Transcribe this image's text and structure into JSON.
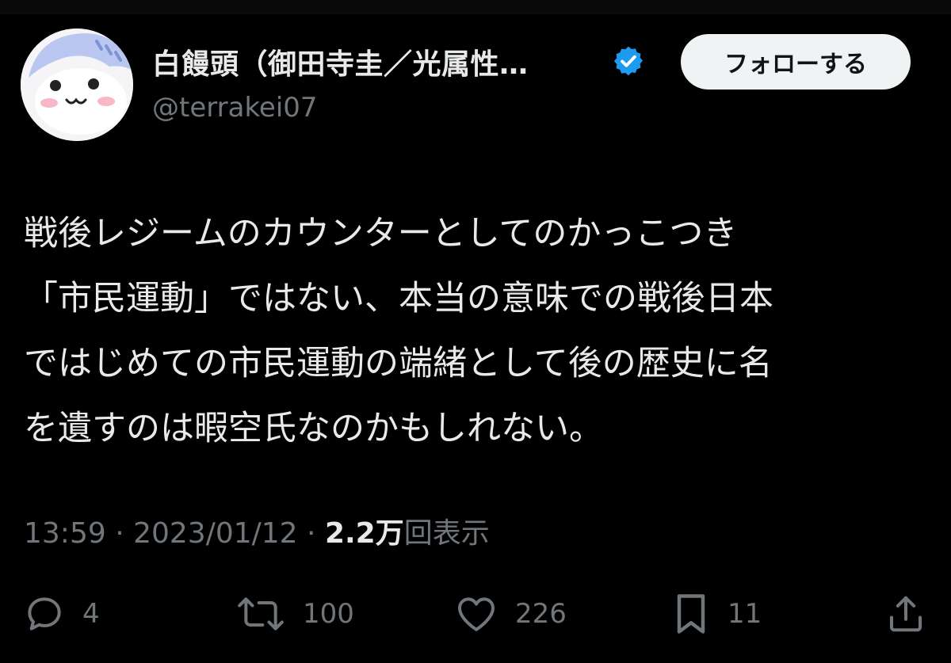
{
  "author": {
    "display_name": "白饅頭（御田寺圭／光属性…",
    "handle": "@terrakei07",
    "verified": true,
    "verified_color": "#1d9bf0"
  },
  "follow_button": {
    "label": "フォローする"
  },
  "tweet": {
    "lines": [
      "戦後レジームのカウンターとしてのかっこつき",
      "「市民運動」ではない、本当の意味での戦後日本",
      "ではじめての市民運動の端緒として後の歴史に名",
      "を遺すのは暇空氏なのかもしれない。"
    ]
  },
  "meta": {
    "time": "13:59",
    "separator": " · ",
    "date": "2023/01/12",
    "views_count": "2.2万",
    "views_label": "回表示"
  },
  "actions": {
    "reply_count": "4",
    "retweet_count": "100",
    "like_count": "226",
    "bookmark_count": "11"
  },
  "icons": {
    "reply": "reply-icon",
    "retweet": "retweet-icon",
    "like": "heart-icon",
    "bookmark": "bookmark-icon",
    "share": "share-icon",
    "verified": "verified-badge-icon"
  },
  "colors": {
    "background": "#000000",
    "text_primary": "#e7e9ea",
    "text_secondary": "#71767b",
    "follow_bg": "#eff3f4"
  }
}
